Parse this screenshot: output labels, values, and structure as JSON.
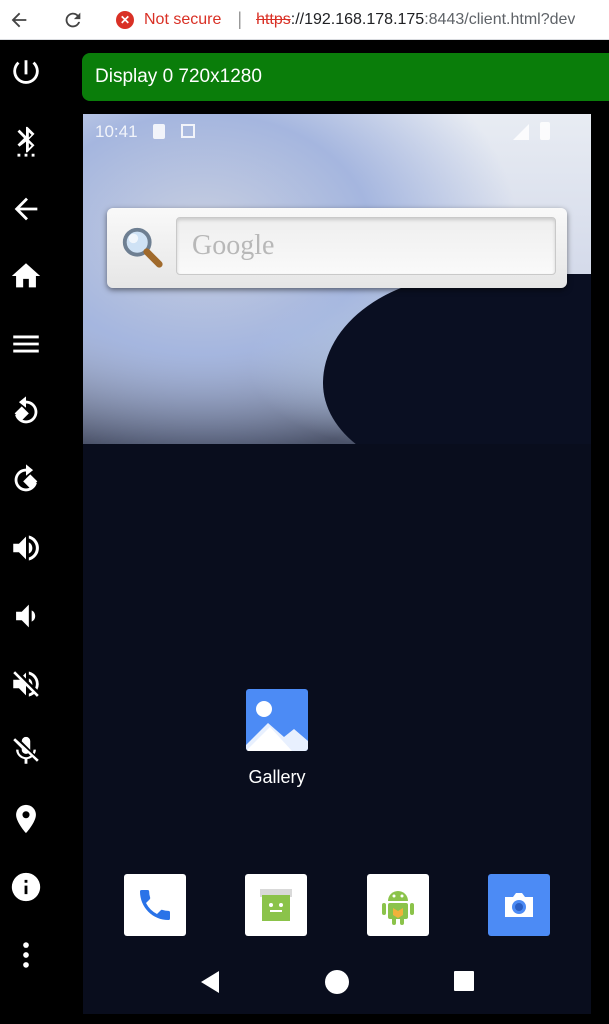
{
  "browser": {
    "security_label": "Not secure",
    "url_scheme": "https",
    "url_host": "://192.168.178.175",
    "url_port_path": ":8443/client.html?dev"
  },
  "display": {
    "title": "Display 0 720x1280"
  },
  "sidebar": {
    "items": [
      {
        "name": "power",
        "icon": "power-icon"
      },
      {
        "name": "bluetooth",
        "icon": "bluetooth-icon"
      },
      {
        "name": "back",
        "icon": "arrow-left-icon"
      },
      {
        "name": "home",
        "icon": "home-icon"
      },
      {
        "name": "menu",
        "icon": "menu-icon"
      },
      {
        "name": "rotate-left",
        "icon": "rotate-left-icon"
      },
      {
        "name": "rotate-right",
        "icon": "rotate-right-icon"
      },
      {
        "name": "volume-up",
        "icon": "volume-up-icon"
      },
      {
        "name": "volume-down",
        "icon": "volume-down-icon"
      },
      {
        "name": "volume-mute",
        "icon": "volume-mute-icon"
      },
      {
        "name": "mic-off",
        "icon": "mic-off-icon"
      },
      {
        "name": "location",
        "icon": "location-icon"
      },
      {
        "name": "info",
        "icon": "info-icon"
      },
      {
        "name": "more",
        "icon": "more-vertical-icon"
      }
    ]
  },
  "device": {
    "status_time": "10:41",
    "search_placeholder": "Google",
    "apps": [
      {
        "label": "Gallery",
        "icon": "gallery-icon"
      }
    ],
    "dock": [
      {
        "name": "phone",
        "icon": "phone-icon"
      },
      {
        "name": "messaging",
        "icon": "messaging-icon"
      },
      {
        "name": "api-demos",
        "icon": "android-icon"
      },
      {
        "name": "camera",
        "icon": "camera-icon"
      }
    ]
  },
  "colors": {
    "display_header": "#0a7d0a",
    "not_secure": "#d93025",
    "gallery_blue": "#4c8bf5",
    "phone_blue": "#2a73e8"
  }
}
